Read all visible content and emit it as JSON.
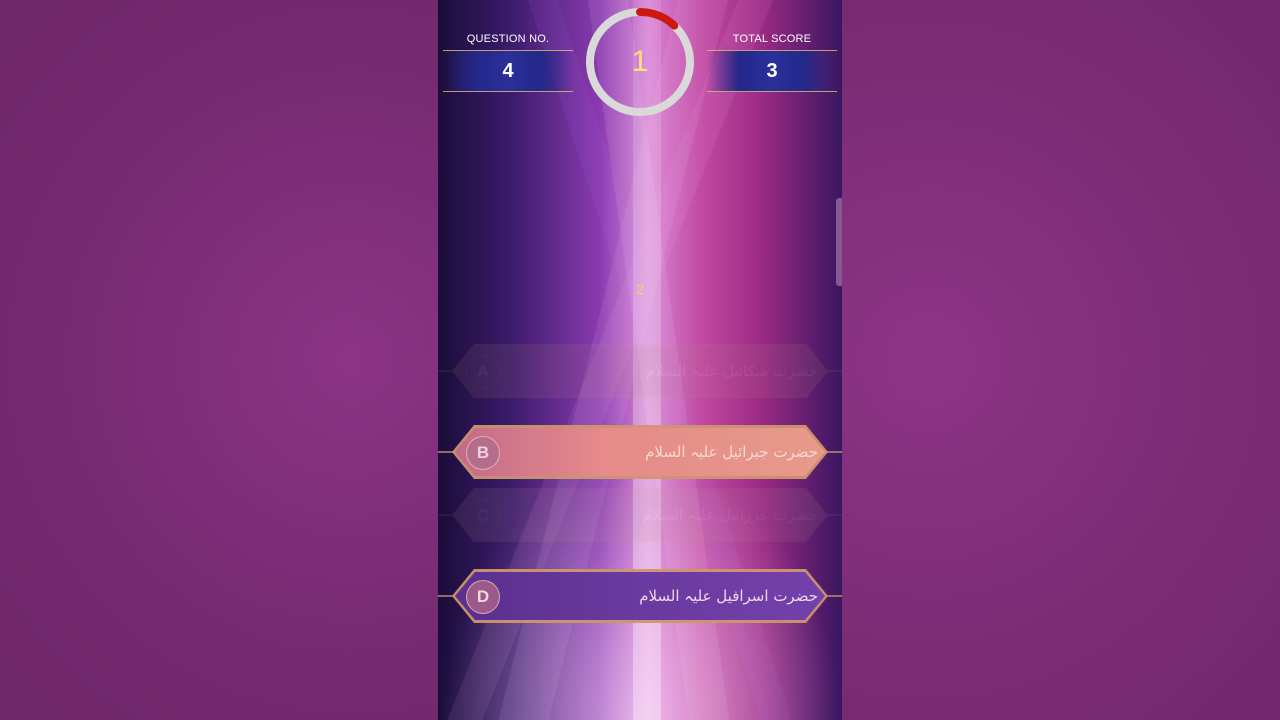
{
  "header": {
    "question_label": "QUESTION NO.",
    "question_number": "4",
    "score_label": "TOTAL SCORE",
    "score_value": "3"
  },
  "timer": {
    "value": "1",
    "remaining_fraction": 0.12,
    "ring_color": "#d9d9d9",
    "progress_color": "#cc1a12"
  },
  "question": {
    "text": "2"
  },
  "answers": [
    {
      "letter": "A",
      "text": "حضرت میکائیل علیہ السلام",
      "state": "faded"
    },
    {
      "letter": "B",
      "text": "حضرت جبرائیل علیہ السلام",
      "state": "highlighted"
    },
    {
      "letter": "C",
      "text": "حضرت عزرائیل علیہ السلام",
      "state": "faded"
    },
    {
      "letter": "D",
      "text": "حضرت اسرافیل علیہ السلام",
      "state": "normal"
    }
  ],
  "colors": {
    "score_box": "#2a2f9a",
    "accent_gold": "#ffd34a",
    "answer_border": "#cd966e"
  }
}
